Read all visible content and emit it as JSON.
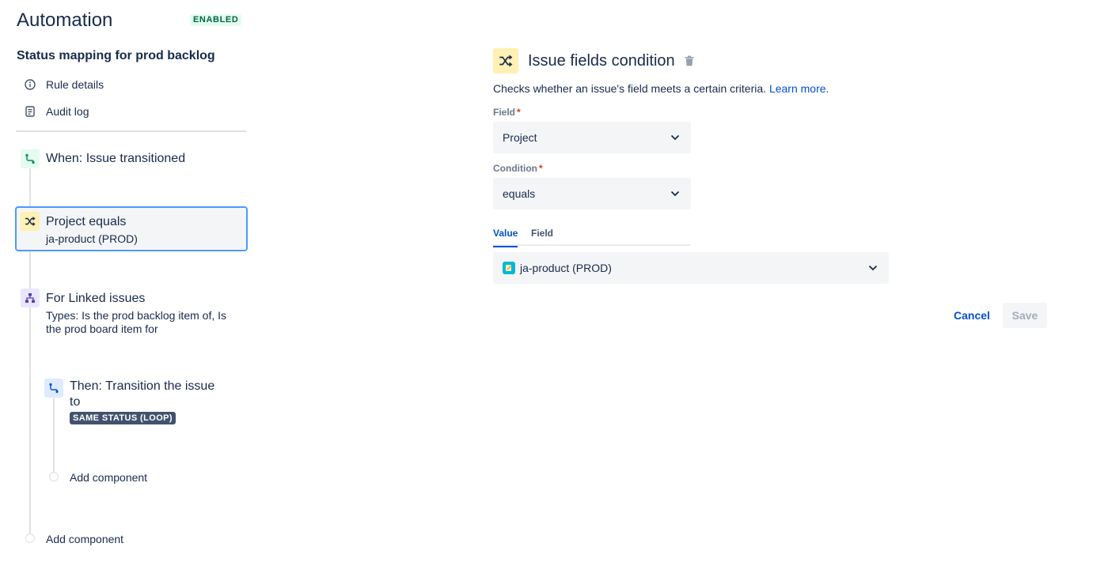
{
  "header": {
    "app_title": "Automation",
    "status": "ENABLED"
  },
  "rule": {
    "name": "Status mapping for prod backlog",
    "nav": [
      {
        "label": "Rule details",
        "icon": "info-icon"
      },
      {
        "label": "Audit log",
        "icon": "document-icon"
      }
    ]
  },
  "flow": {
    "trigger": {
      "title": "When: Issue transitioned",
      "icon": "transition-icon"
    },
    "condition": {
      "title": "Project equals",
      "subtitle": "ja-product (PROD)",
      "icon": "shuffle-icon"
    },
    "branch": {
      "title": "For Linked issues",
      "subtitle_line1": "Types: Is the prod backlog item of, Is",
      "subtitle_line2": "the prod board item for",
      "icon": "hierarchy-icon"
    },
    "action": {
      "title_line1": "Then: Transition the issue",
      "title_line2": "to",
      "badge": "SAME STATUS (LOOP)",
      "icon": "transition-icon"
    },
    "add_inner": "Add component",
    "add_outer": "Add component"
  },
  "panel": {
    "title": "Issue fields condition",
    "description": "Checks whether an issue's field meets a certain criteria.",
    "learn_more": "Learn more.",
    "field_label": "Field",
    "field_value": "Project",
    "condition_label": "Condition",
    "condition_value": "equals",
    "tabs": [
      {
        "label": "Value",
        "active": true
      },
      {
        "label": "Field",
        "active": false
      }
    ],
    "value_selected": "ja-product (PROD)",
    "cancel_label": "Cancel",
    "save_label": "Save"
  },
  "colors": {
    "accent": "#0052cc",
    "selection_border": "#4c9aff",
    "enabled_bg": "#e3fcef",
    "enabled_text": "#006644",
    "condition_bg": "#fff0b3",
    "required": "#de350b"
  }
}
